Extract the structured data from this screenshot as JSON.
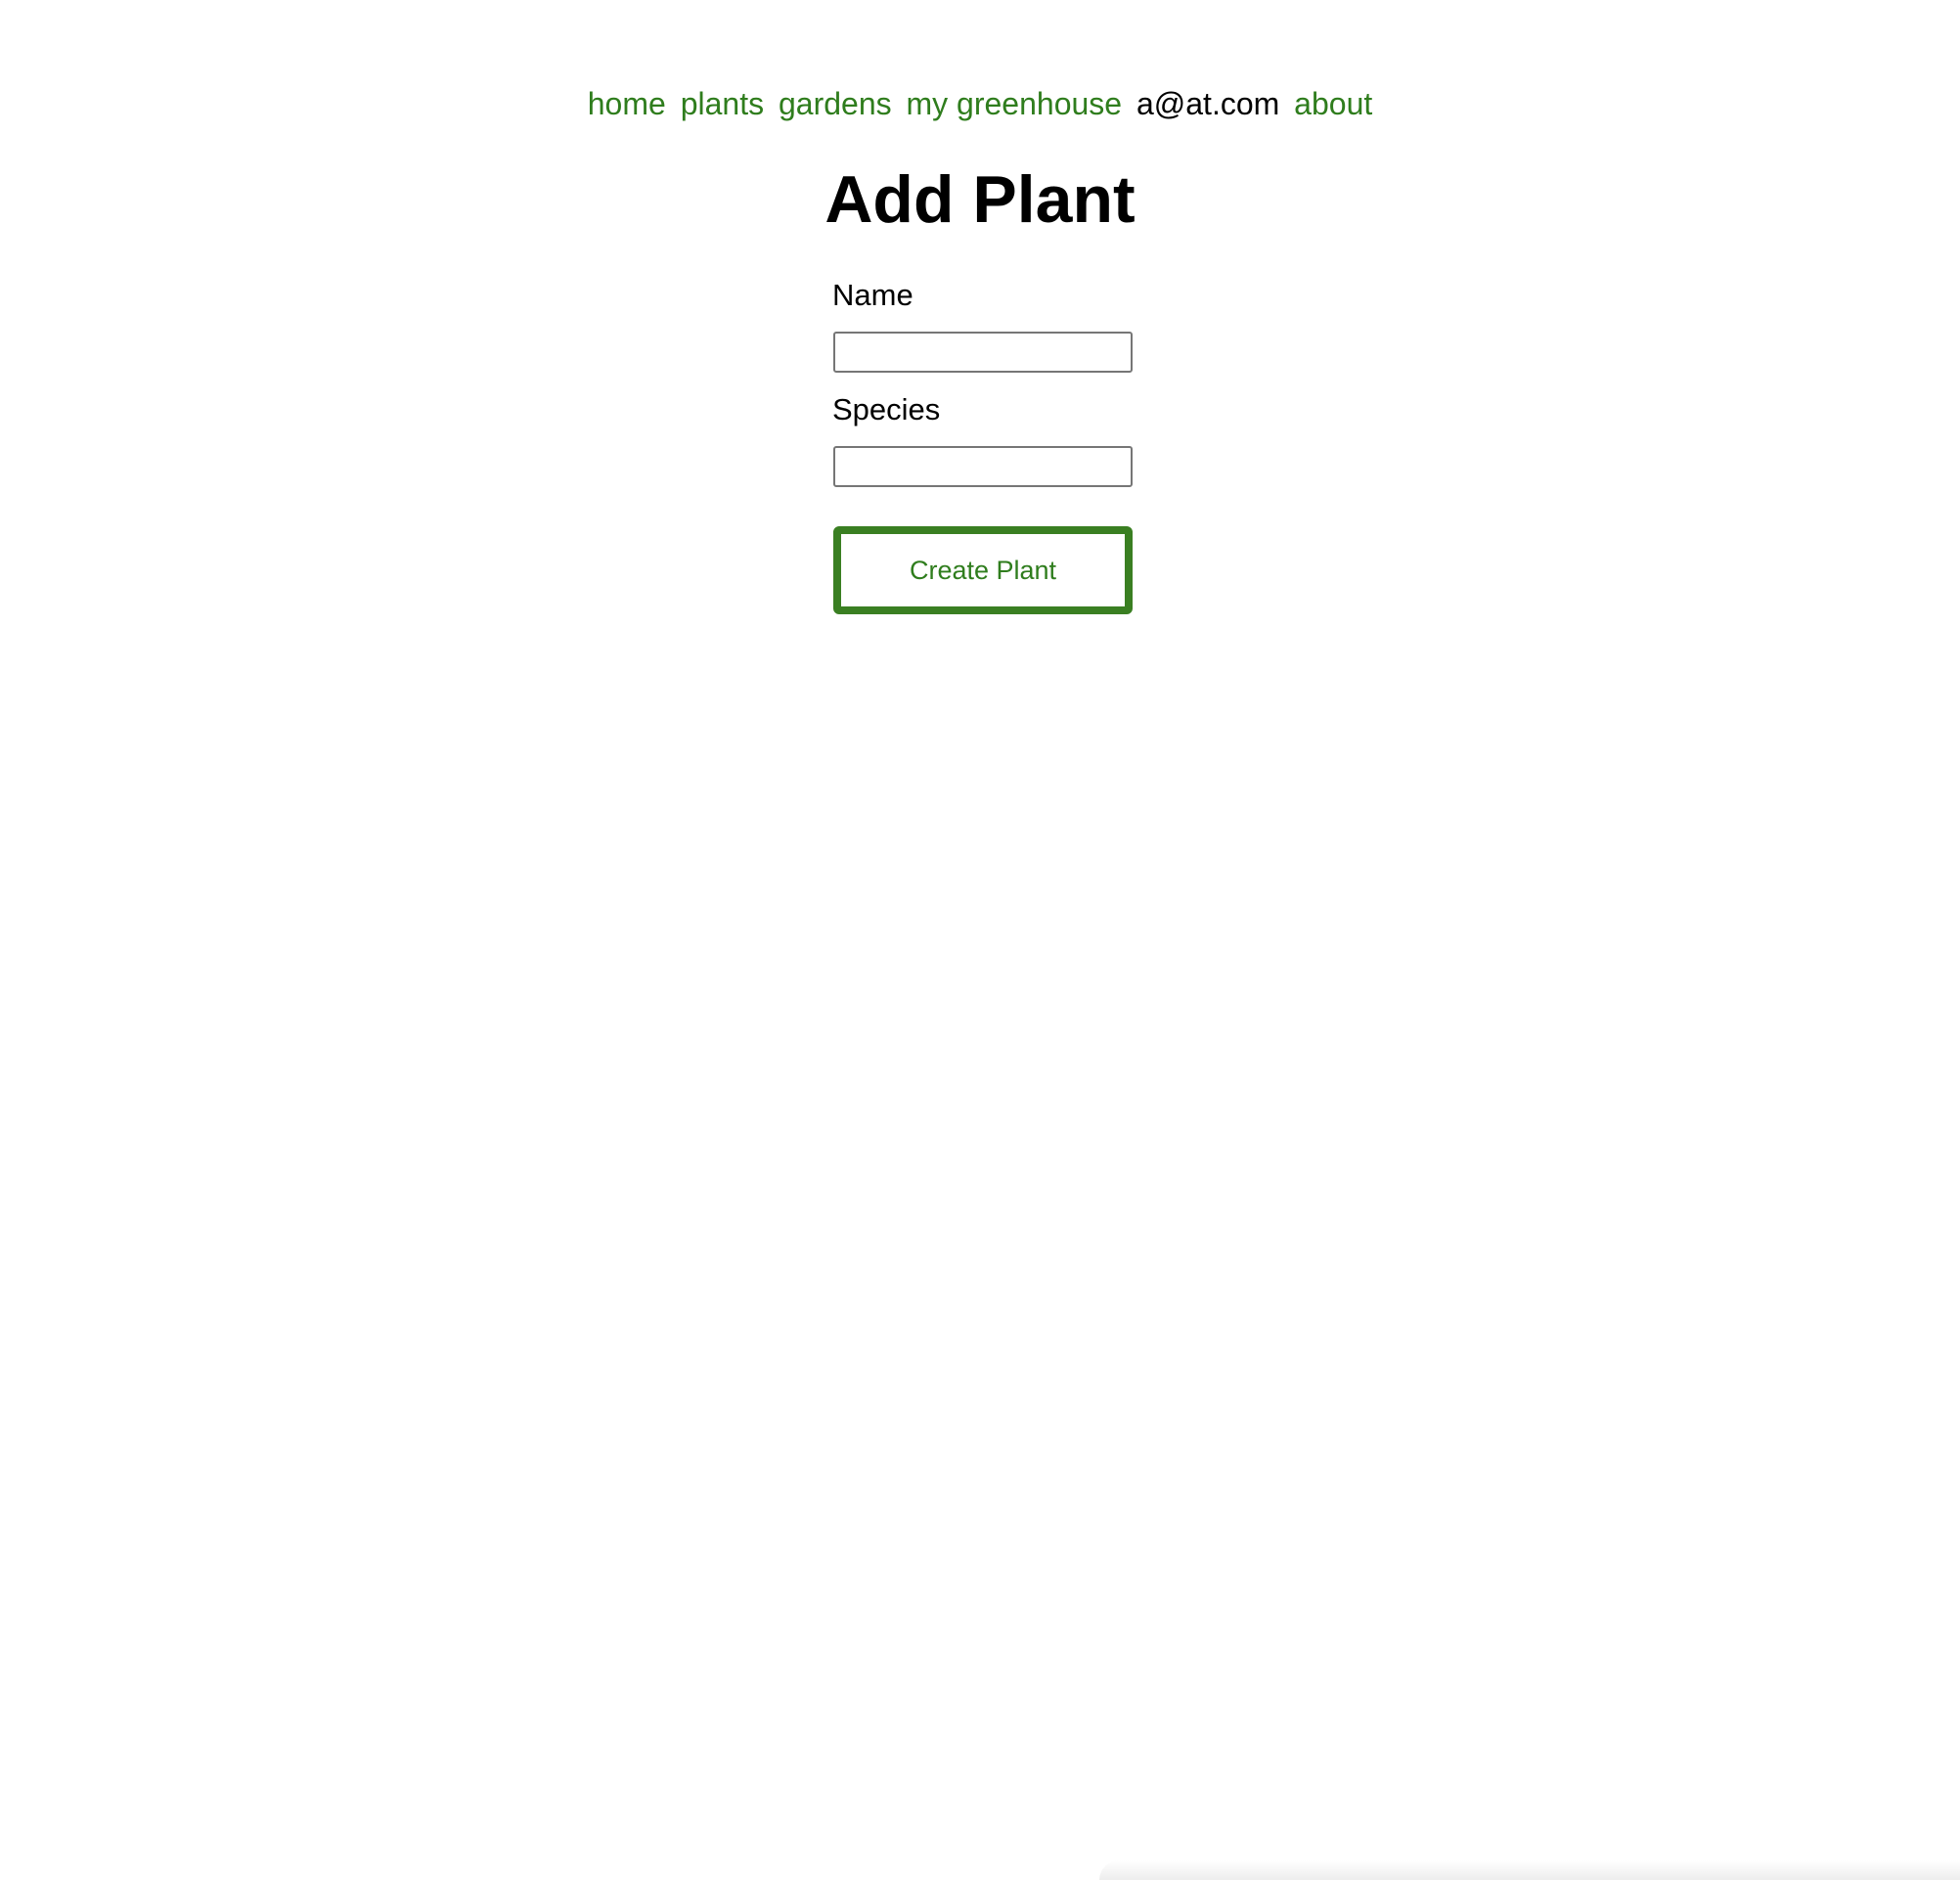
{
  "nav": {
    "home": "home",
    "plants": "plants",
    "gardens": "gardens",
    "greenhouse": "my greenhouse",
    "user_email": "a@at.com",
    "about": "about"
  },
  "page": {
    "title": "Add Plant"
  },
  "form": {
    "name_label": "Name",
    "name_value": "",
    "species_label": "Species",
    "species_value": "",
    "submit_label": "Create Plant"
  },
  "colors": {
    "link": "#2f7d1d",
    "button_border": "#3a7f22",
    "text": "#000000",
    "background": "#ffffff"
  }
}
